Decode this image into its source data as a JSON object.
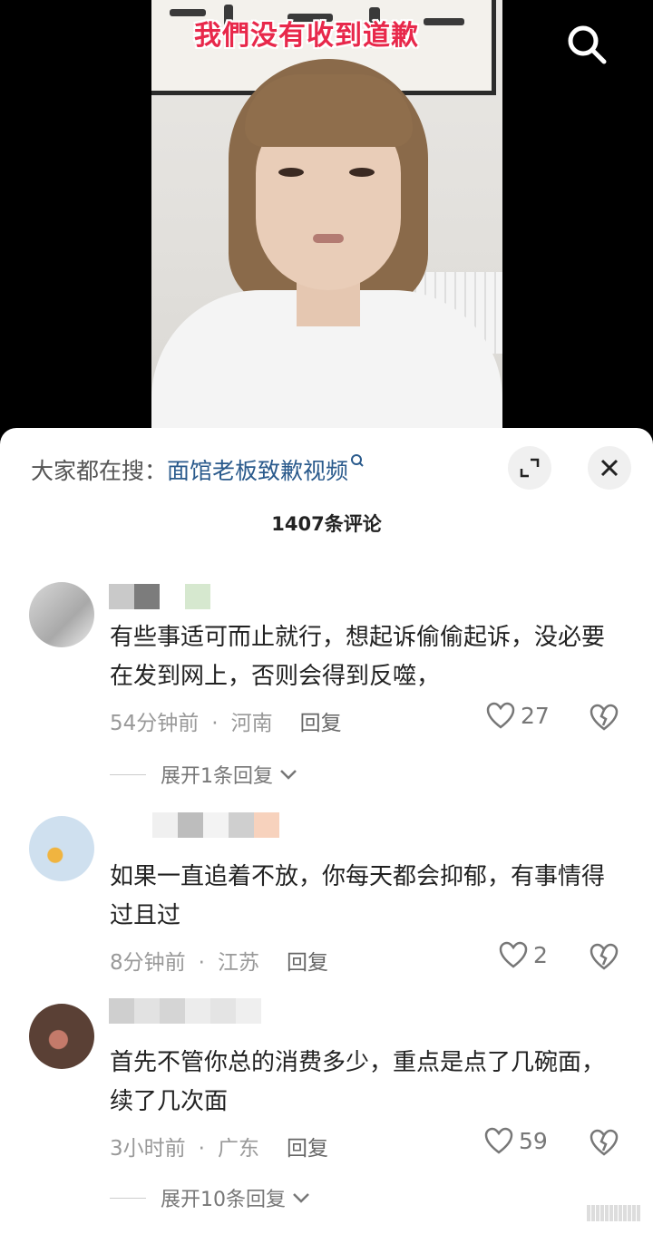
{
  "video": {
    "caption": "我們没有收到道歉"
  },
  "hot_search": {
    "prefix": "大家都在搜：",
    "term": "面馆老板致歉视频"
  },
  "comments_header": {
    "title": "1407条评论"
  },
  "comments": [
    {
      "text": "有些事适可而止就行，想起诉偷偷起诉，没必要在发到网上，否则会得到反噬，",
      "time": "54分钟前",
      "location": "河南",
      "reply_label": "回复",
      "likes": "27",
      "expand_label": "展开1条回复"
    },
    {
      "text": "如果一直追着不放，你每天都会抑郁，有事情得过且过",
      "time": "8分钟前",
      "location": "江苏",
      "reply_label": "回复",
      "likes": "2"
    },
    {
      "text": "首先不管你总的消费多少，重点是点了几碗面，续了几次面",
      "time": "3小时前",
      "location": "广东",
      "reply_label": "回复",
      "likes": "59",
      "expand_label": "展开10条回复"
    }
  ],
  "icons": {
    "search": "search-icon",
    "expand": "expand-icon",
    "close": "close-icon",
    "like": "heart-icon",
    "dislike": "broken-heart-icon",
    "chevron": "chevron-down-icon"
  },
  "colors": {
    "caption": "#e8284b",
    "search_term": "#2a5a8c",
    "meta": "#999999"
  }
}
